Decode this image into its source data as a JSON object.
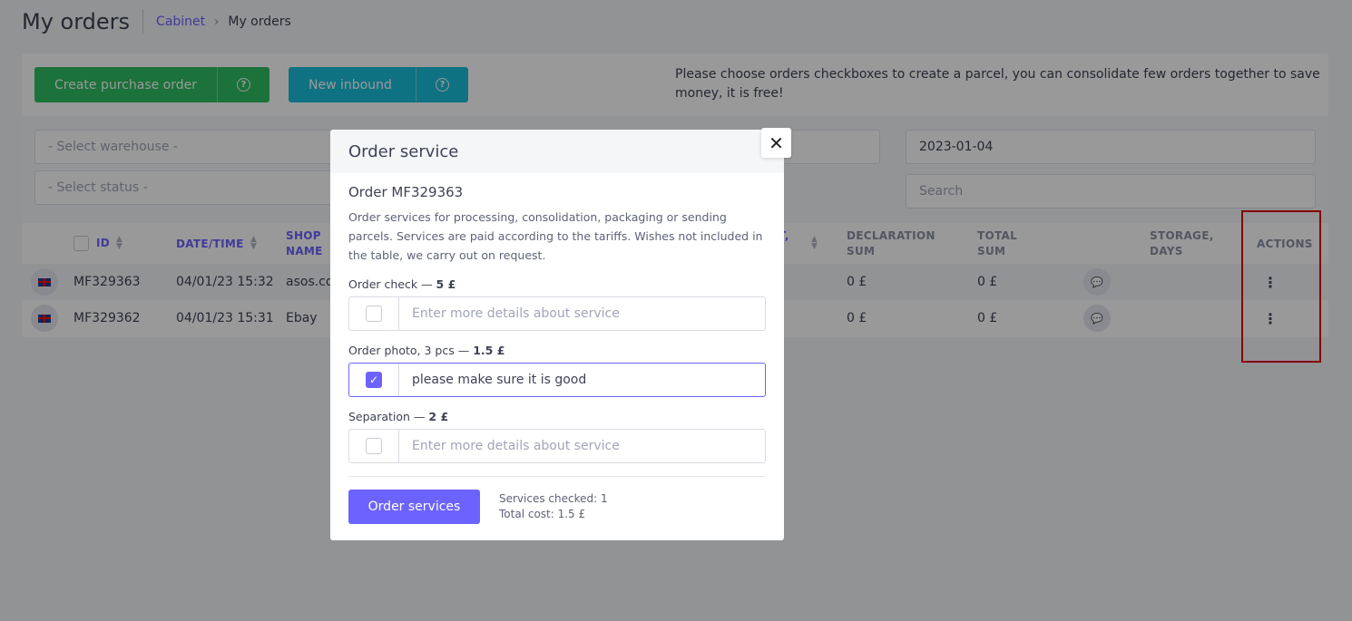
{
  "header": {
    "title": "My orders",
    "breadcrumb_parent": "Cabinet",
    "breadcrumb_sep": "›",
    "breadcrumb_current": "My orders"
  },
  "toolbar": {
    "create_order_label": "Create purchase order",
    "new_inbound_label": "New inbound",
    "help_glyph": "?",
    "hint": "Please choose orders checkboxes to create a parcel, you can consolidate few orders together to save money, it is free!"
  },
  "filters": {
    "warehouse_placeholder": "- Select warehouse -",
    "status_placeholder": "- Select status -",
    "date_value": "2023-01-04",
    "search_placeholder": "Search"
  },
  "table": {
    "columns": {
      "id": "ID",
      "datetime": "DATE/TIME",
      "shop_name_1": "SHOP",
      "shop_name_2": "NAME",
      "hidden_col": "T,",
      "declaration_1": "DECLARATION",
      "declaration_2": "SUM",
      "total_1": "TOTAL",
      "total_2": "SUM",
      "storage_1": "STORAGE,",
      "storage_2": "DAYS",
      "actions": "ACTIONS"
    },
    "rows": [
      {
        "id": "MF329363",
        "datetime": "04/01/23 15:32",
        "shop": "asos.co",
        "declaration": "0 £",
        "total": "0 £"
      },
      {
        "id": "MF329362",
        "datetime": "04/01/23 15:31",
        "shop": "Ebay",
        "declaration": "0 £",
        "total": "0 £"
      }
    ]
  },
  "modal": {
    "title": "Order service",
    "close_glyph": "✕",
    "order_title": "Order MF329363",
    "description": "Order services for processing, consolidation, packaging or sending parcels. Services are paid according to the tariffs. Wishes not included in the table, we carry out on request.",
    "services": [
      {
        "label": "Order check",
        "price": "5 £",
        "checked": false,
        "value": "",
        "placeholder": "Enter more details about service"
      },
      {
        "label": "Order photo, 3 pcs",
        "price": "1.5 £",
        "checked": true,
        "value": "please make sure it is good",
        "placeholder": "Enter more details about service"
      },
      {
        "label": "Separation",
        "price": "2 £",
        "checked": false,
        "value": "",
        "placeholder": "Enter more details about service"
      }
    ],
    "submit_label": "Order services",
    "services_checked": "Services checked: 1",
    "total_cost": "Total cost: 1.5 £"
  },
  "colors": {
    "accent": "#6c63ff",
    "create_btn": "#2dbe62",
    "inbound_btn": "#19bfd9",
    "highlight": "#e00000"
  }
}
